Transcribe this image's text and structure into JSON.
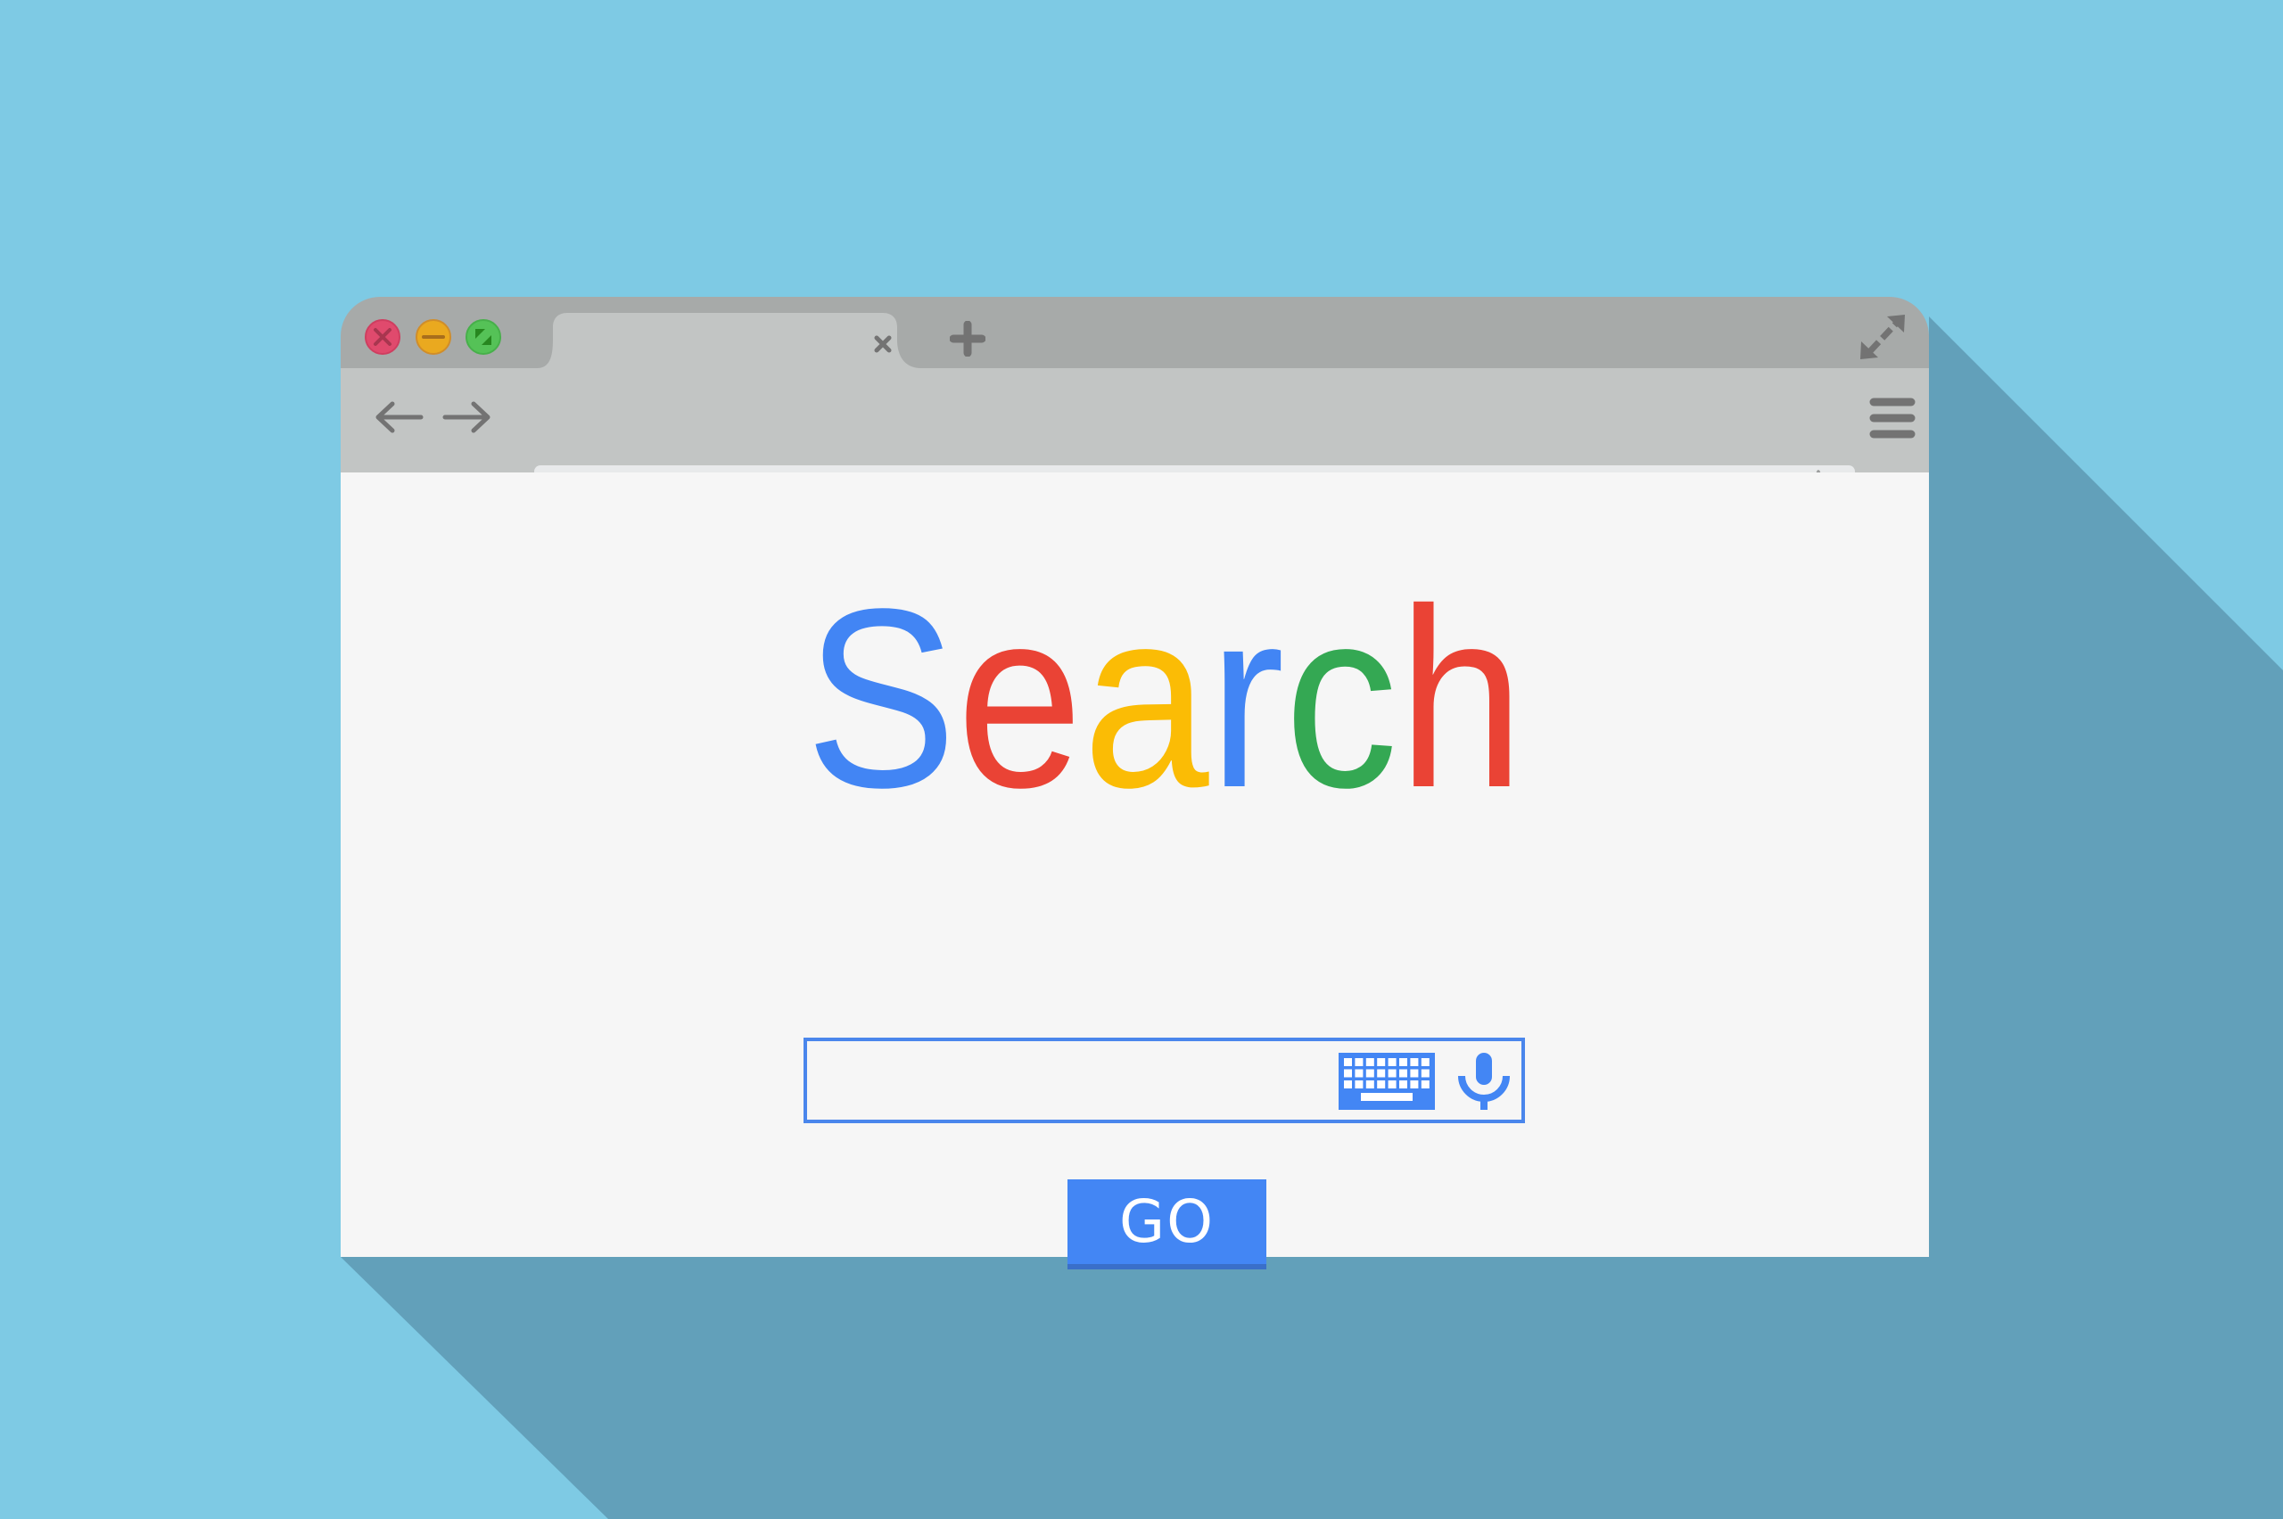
{
  "colors": {
    "background": "#7ecae4",
    "shadow": "#62a0ba",
    "titlebar": "#a7aaa9",
    "toolbar": "#c2c5c4",
    "address_bar": "#e8eaeb",
    "content": "#f6f6f6",
    "icon_gray": "#737373",
    "accent_blue": "#4386f4"
  },
  "window_controls": [
    {
      "name": "close",
      "icon": "close-icon",
      "color": "#e04a6d",
      "glyph_color": "#a8364f"
    },
    {
      "name": "minimize",
      "icon": "minimize-icon",
      "color": "#eaa91f",
      "glyph_color": "#a86e1c"
    },
    {
      "name": "maximize",
      "icon": "maximize-icon",
      "color": "#55c257",
      "glyph_color": "#27871f"
    }
  ],
  "tabs": [
    {
      "label": "",
      "active": true,
      "close_icon": "close-tab-icon"
    }
  ],
  "new_tab_icon": "plus-icon",
  "fullscreen_icon": "expand-arrows-icon",
  "toolbar": {
    "back_icon": "arrow-left-icon",
    "forward_icon": "arrow-right-icon",
    "reload_icon": "reload-icon",
    "address": {
      "value": "",
      "placeholder": ""
    },
    "bookmark_icon": "star-icon",
    "menu_icon": "hamburger-menu-icon"
  },
  "page": {
    "logo": {
      "letters": [
        {
          "char": "S",
          "color": "#4285f4"
        },
        {
          "char": "e",
          "color": "#ea4335"
        },
        {
          "char": "a",
          "color": "#fbbc05"
        },
        {
          "char": "r",
          "color": "#4285f4"
        },
        {
          "char": "c",
          "color": "#34a853"
        },
        {
          "char": "h",
          "color": "#ea4335"
        }
      ]
    },
    "search": {
      "value": "",
      "placeholder": "",
      "keyboard_icon": "keyboard-icon",
      "mic_icon": "microphone-icon"
    },
    "go_button_label": "GO"
  }
}
